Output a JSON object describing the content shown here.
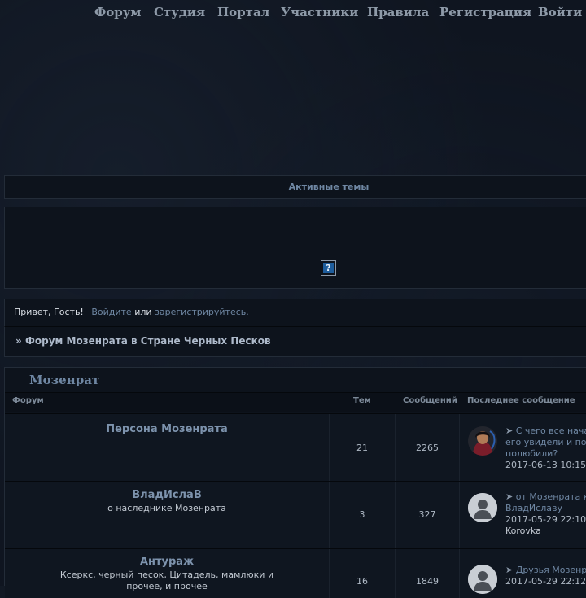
{
  "nav": {
    "forum": "Форум",
    "studio": "Студия",
    "portal": "Портал",
    "members": "Участники",
    "rules": "Правила",
    "register": "Регистрация",
    "login": "Войти"
  },
  "active_topics": "Активные темы",
  "help_icon": "?",
  "greeting": {
    "hello": "Привет, Гость!",
    "login_link": "Войдите",
    "or": "или",
    "register_link": "зарегистрируйтесь."
  },
  "breadcrumb": {
    "prefix": "»",
    "title": "Форум Мозенрата в Стране Черных Песков"
  },
  "category": {
    "title": "Мозенрат",
    "columns": {
      "forum": "Форум",
      "topics": "Тем",
      "posts": "Сообщений",
      "last": "Последнее сообщение"
    },
    "forums": [
      {
        "name": "Персона Мозенрата",
        "desc": "",
        "topics": "21",
        "posts": "2265",
        "last_line1": "С чего все нача",
        "last_line2": "его увидели и по",
        "last_line3": "полюбили?",
        "last_date": "2017-06-13 10:15",
        "last_user": ""
      },
      {
        "name": "ВладИслаВ",
        "desc": "о наследнике Мозенрата",
        "topics": "3",
        "posts": "327",
        "last_line1": "от Мозенрата к",
        "last_line2": "ВладИславу",
        "last_date": "2017-05-29 22:10",
        "last_user": "Korovka"
      },
      {
        "name": "Антураж",
        "desc": "Ксеркс, черный песок, Цитадель, мамлюки и прочее, и прочее",
        "topics": "16",
        "posts": "1849",
        "last_line1": "Друзья Мозенр",
        "last_date": "2017-05-29 22:12"
      }
    ]
  },
  "icons": {
    "topic_arrow": "arrow-right-icon",
    "help": "question-icon"
  }
}
